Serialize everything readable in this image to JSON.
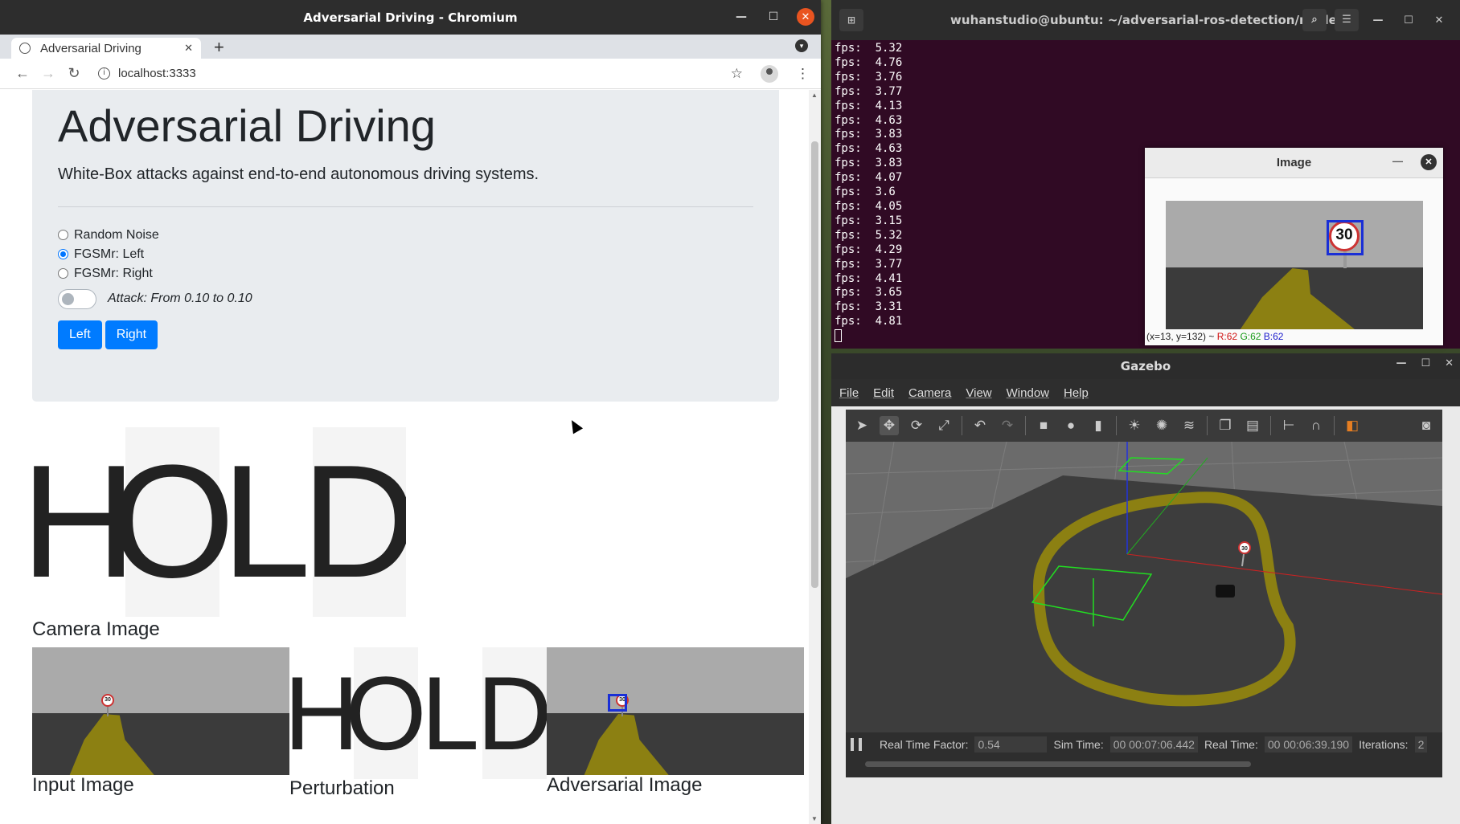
{
  "chromium": {
    "window_title": "Adversarial Driving - Chromium",
    "tab_title": "Adversarial Driving",
    "url": "localhost:3333",
    "page": {
      "heading": "Adversarial Driving",
      "lead": "White-Box attacks against end-to-end autonomous driving systems.",
      "radios": [
        {
          "label": "Random Noise",
          "checked": false
        },
        {
          "label": "FGSMr: Left",
          "checked": true
        },
        {
          "label": "FGSMr: Right",
          "checked": false
        }
      ],
      "attack_label": "Attack: From 0.10 to 0.10",
      "left_button": "Left",
      "right_button": "Right",
      "hold_letters": [
        "H",
        "O",
        "L",
        "D"
      ],
      "camera_caption": "Camera Image",
      "input_caption": "Input Image",
      "perturbation_caption": "Perturbation",
      "adversarial_caption": "Adversarial Image",
      "sign_text": "30"
    }
  },
  "terminal": {
    "title": "wuhanstudio@ubuntu: ~/adversarial-ros-detection/model",
    "lines": [
      "fps:  5.32",
      "fps:  4.76",
      "fps:  3.76",
      "fps:  3.77",
      "fps:  4.13",
      "fps:  4.63",
      "fps:  3.83",
      "fps:  4.63",
      "fps:  3.83",
      "fps:  4.07",
      "fps:  3.6",
      "fps:  4.05",
      "fps:  3.15",
      "fps:  5.32",
      "fps:  4.29",
      "fps:  3.77",
      "fps:  4.41",
      "fps:  3.65",
      "fps:  3.31",
      "fps:  4.81"
    ]
  },
  "image_window": {
    "title": "Image",
    "sign_text": "30",
    "status_coords": "(x=13, y=132) ~",
    "r": "R:62",
    "g": "G:62",
    "b": "B:62"
  },
  "gazebo": {
    "title": "Gazebo",
    "menu": [
      "File",
      "Edit",
      "Camera",
      "View",
      "Window",
      "Help"
    ],
    "rtf_label": "Real Time Factor:",
    "rtf_value": "0.54",
    "sim_time_label": "Sim Time:",
    "sim_time_value": "00 00:07:06.442",
    "real_time_label": "Real Time:",
    "real_time_value": "00 00:06:39.190",
    "iterations_label": "Iterations:",
    "iterations_value": "2",
    "sign_text": "30"
  },
  "colors": {
    "primary_button": "#007bff",
    "terminal_bg": "#300a24",
    "road": "#8c8012",
    "ubuntu_close": "#e95420"
  }
}
